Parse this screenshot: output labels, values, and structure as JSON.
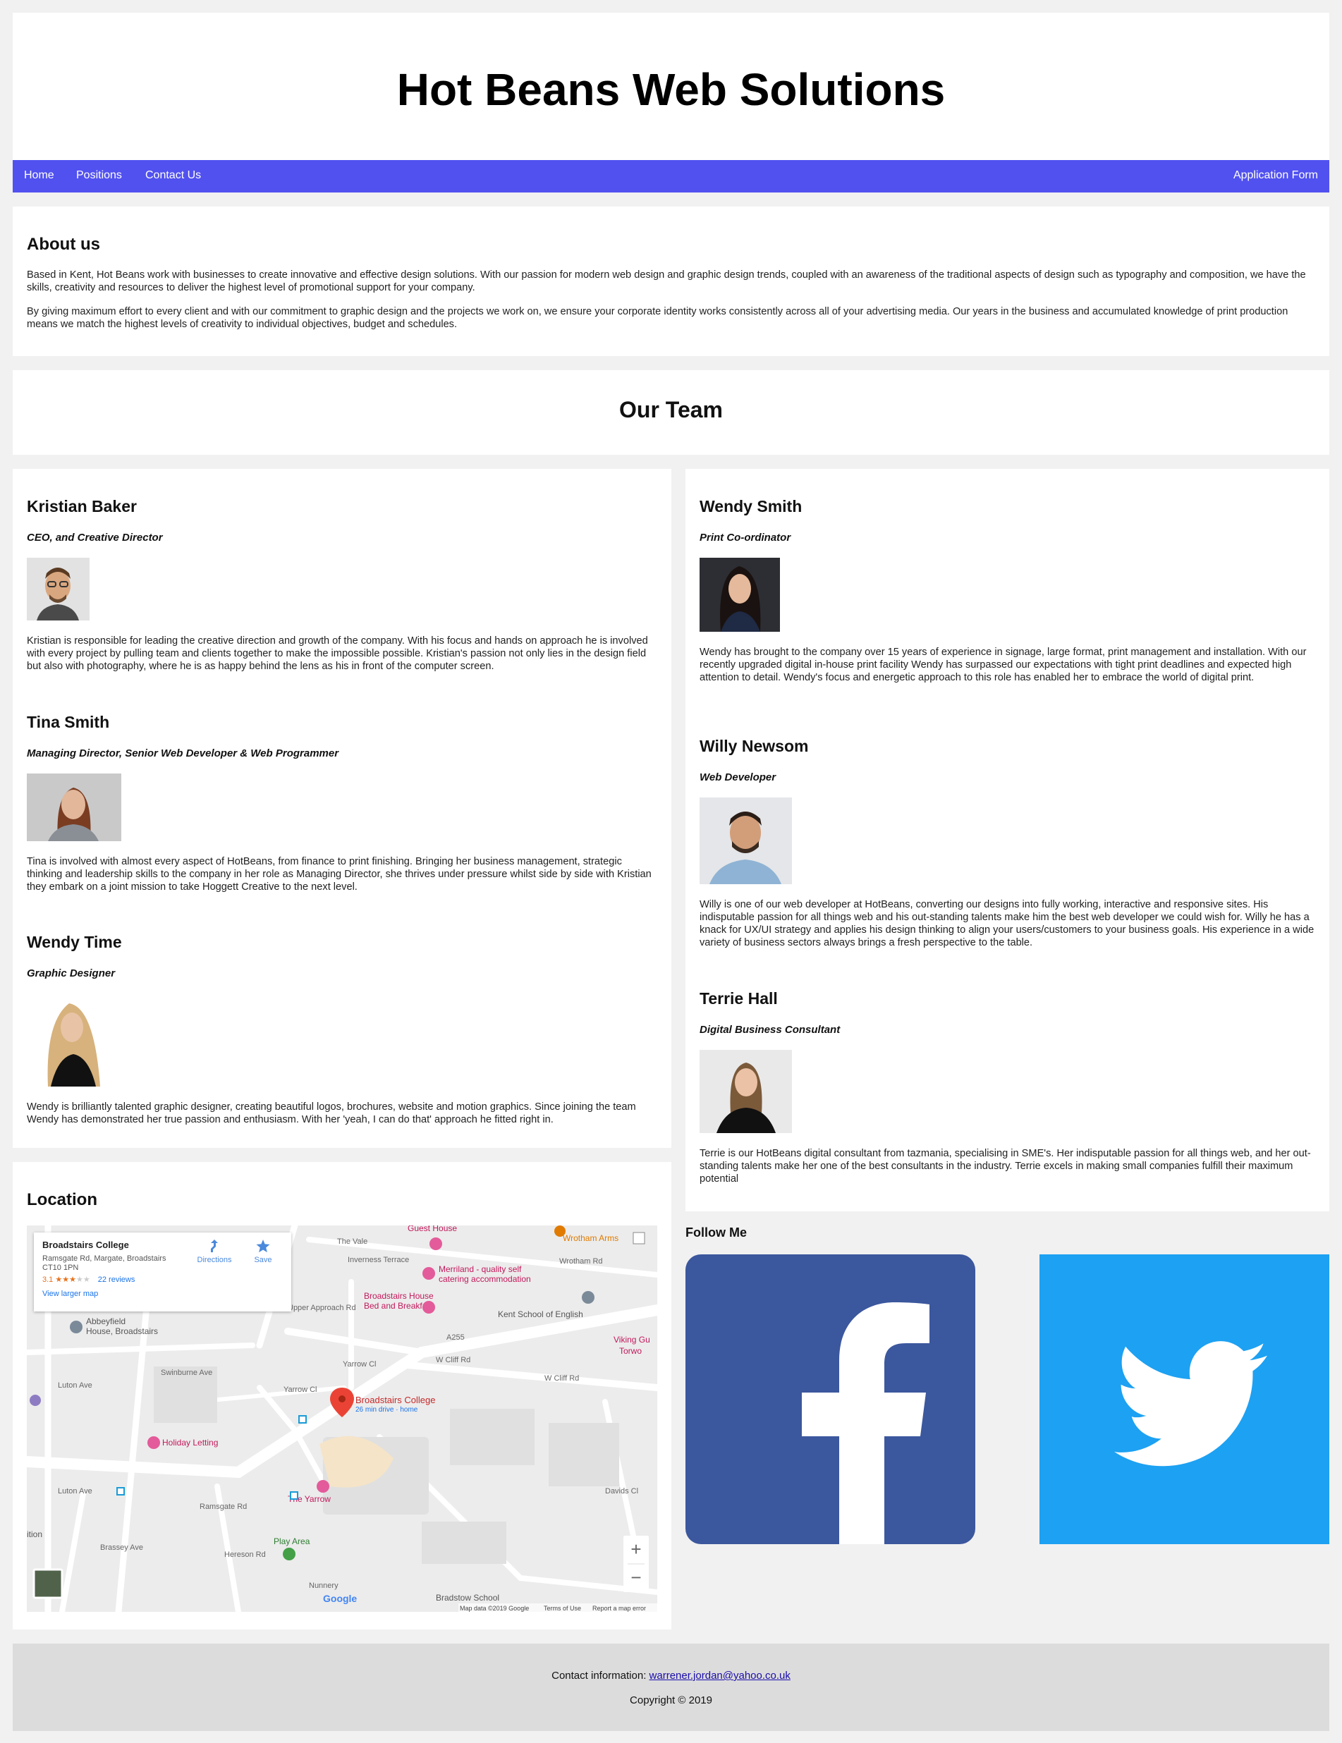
{
  "header": {
    "title": "Hot Beans Web Solutions"
  },
  "nav": {
    "home": "Home",
    "positions": "Positions",
    "contact": "Contact Us",
    "application": "Application Form",
    "bg_color": "#5151f0"
  },
  "about": {
    "heading": "About us",
    "p1": "Based in Kent, Hot Beans work with businesses to create innovative and effective design solutions. With our passion for modern web design and graphic design trends, coupled with an awareness of the traditional aspects of design such as typography and composition, we have the skills, creativity and resources to deliver the highest level of promotional support for your company.",
    "p2": "By giving maximum effort to every client and with our commitment to graphic design and the projects we work on, we ensure your corporate identity works consistently across all of your advertising media. Our years in the business and accumulated knowledge of print production means we match the highest levels of creativity to individual objectives, budget and schedules."
  },
  "team": {
    "heading": "Our Team",
    "left": [
      {
        "name": "Kristian Baker",
        "role": "CEO, and Creative Director",
        "bio": "Kristian is responsible for leading the creative direction and growth of the company. With his focus and hands on approach he is involved with every project by pulling team and clients together to make the impossible possible. Kristian's passion not only lies in the design field but also with photography, where he is as happy behind the lens as his in front of the computer screen."
      },
      {
        "name": "Tina Smith",
        "role": "Managing Director, Senior Web Developer & Web Programmer",
        "bio": "Tina is involved with almost every aspect of HotBeans, from finance to print finishing. Bringing her business management, strategic thinking and leadership skills to the company in her role as Managing Director, she thrives under pressure whilst side by side with Kristian they embark on a joint mission to take Hoggett Creative to the next level."
      },
      {
        "name": "Wendy Time",
        "role": "Graphic Designer",
        "bio": "Wendy is brilliantly talented graphic designer, creating beautiful logos, brochures, website and motion graphics. Since joining the team Wendy has demonstrated her true passion and enthusiasm. With her 'yeah, I can do that' approach he fitted right in."
      }
    ],
    "right": [
      {
        "name": "Wendy Smith",
        "role": "Print Co-ordinator",
        "bio": "Wendy has brought to the company over 15 years of experience in signage, large format, print management and installation. With our recently upgraded digital in-house print facility Wendy has surpassed our expectations with tight print deadlines and expected high attention to detail. Wendy's focus and energetic approach to this role has enabled her to embrace the world of digital print."
      },
      {
        "name": "Willy Newsom",
        "role": "Web Developer",
        "bio": "Willy is one of our web developer at HotBeans, converting our designs into fully working, interactive and responsive sites. His indisputable passion for all things web and his out-standing talents make him the best web developer we could wish for. Willy he has a knack for UX/UI strategy and applies his design thinking to align your users/customers to your business goals. His experience in a wide variety of business sectors always brings a fresh perspective to the table."
      },
      {
        "name": "Terrie Hall",
        "role": "Digital Business Consultant",
        "bio": "Terrie is our HotBeans digital consultant from tazmania, specialising in SME's. Her indisputable passion for all things web, and her out-standing talents make her one of the best consultants in the industry. Terrie excels in making small companies fulfill their maximum potential"
      }
    ]
  },
  "location": {
    "heading": "Location",
    "map": {
      "place_name": "Broadstairs College",
      "address_line1": "Ramsgate Rd, Margate, Broadstairs",
      "address_line2": "CT10 1PN",
      "rating": "3.1",
      "stars": "★★★",
      "stars_empty": "★★",
      "reviews": "22 reviews",
      "view_larger": "View larger map",
      "directions": "Directions",
      "save": "Save",
      "pin_label": "Broadstairs College",
      "pin_sub": "26 min drive · home",
      "labels": {
        "guest_house": "Guest House",
        "wrotham_arms": "Wrotham Arms",
        "the_vale": "The Vale",
        "inverness": "Inverness Terrace",
        "wrotham_rd": "Wrotham Rd",
        "merriland": "Merriland - quality self",
        "merriland2": "catering accommodation",
        "bh_house": "Broadstairs House",
        "bh_house2": "Bed and Breakfast",
        "kent_school": "Kent School of English",
        "abbeyfield": "Abbeyfield",
        "abbeyfield2": "House, Broadstairs",
        "viking": "Viking Gu",
        "torwood": "Torwo",
        "a255": "A255",
        "w_cliff_rd": "W Cliff Rd",
        "w_cliff_rd2": "W Cliff Rd",
        "holiday": "Holiday Letting",
        "the_yarrow": "The Yarrow",
        "ramsgate_rd": "Ramsgate Rd",
        "play_area": "Play Area",
        "bradstow": "Bradstow School",
        "swinburne": "Swinburne Ave",
        "luton_ave": "Luton Ave",
        "luton_ave2": "Luton Ave",
        "upper_approach": "Upper Approach Rd",
        "yarrow_cl": "Yarrow Cl",
        "yarrow_cl2": "Yarrow Cl",
        "brassey": "Brassey Ave",
        "hereson": "Hereson Rd",
        "davids": "Davids Cl",
        "ition": "ition",
        "nuns": "Nunnery"
      },
      "attribution": "Map data ©2019 Google",
      "terms": "Terms of Use",
      "report": "Report a map error",
      "google": "Google",
      "zoom_in": "+",
      "zoom_out": "−"
    }
  },
  "follow": {
    "heading": "Follow Me",
    "facebook_color": "#3b579d",
    "twitter_color": "#1da1f2"
  },
  "footer": {
    "contact_label": "Contact information: ",
    "email": "warrener.jordan@yahoo.co.uk",
    "copyright": "Copyright © 2019"
  }
}
